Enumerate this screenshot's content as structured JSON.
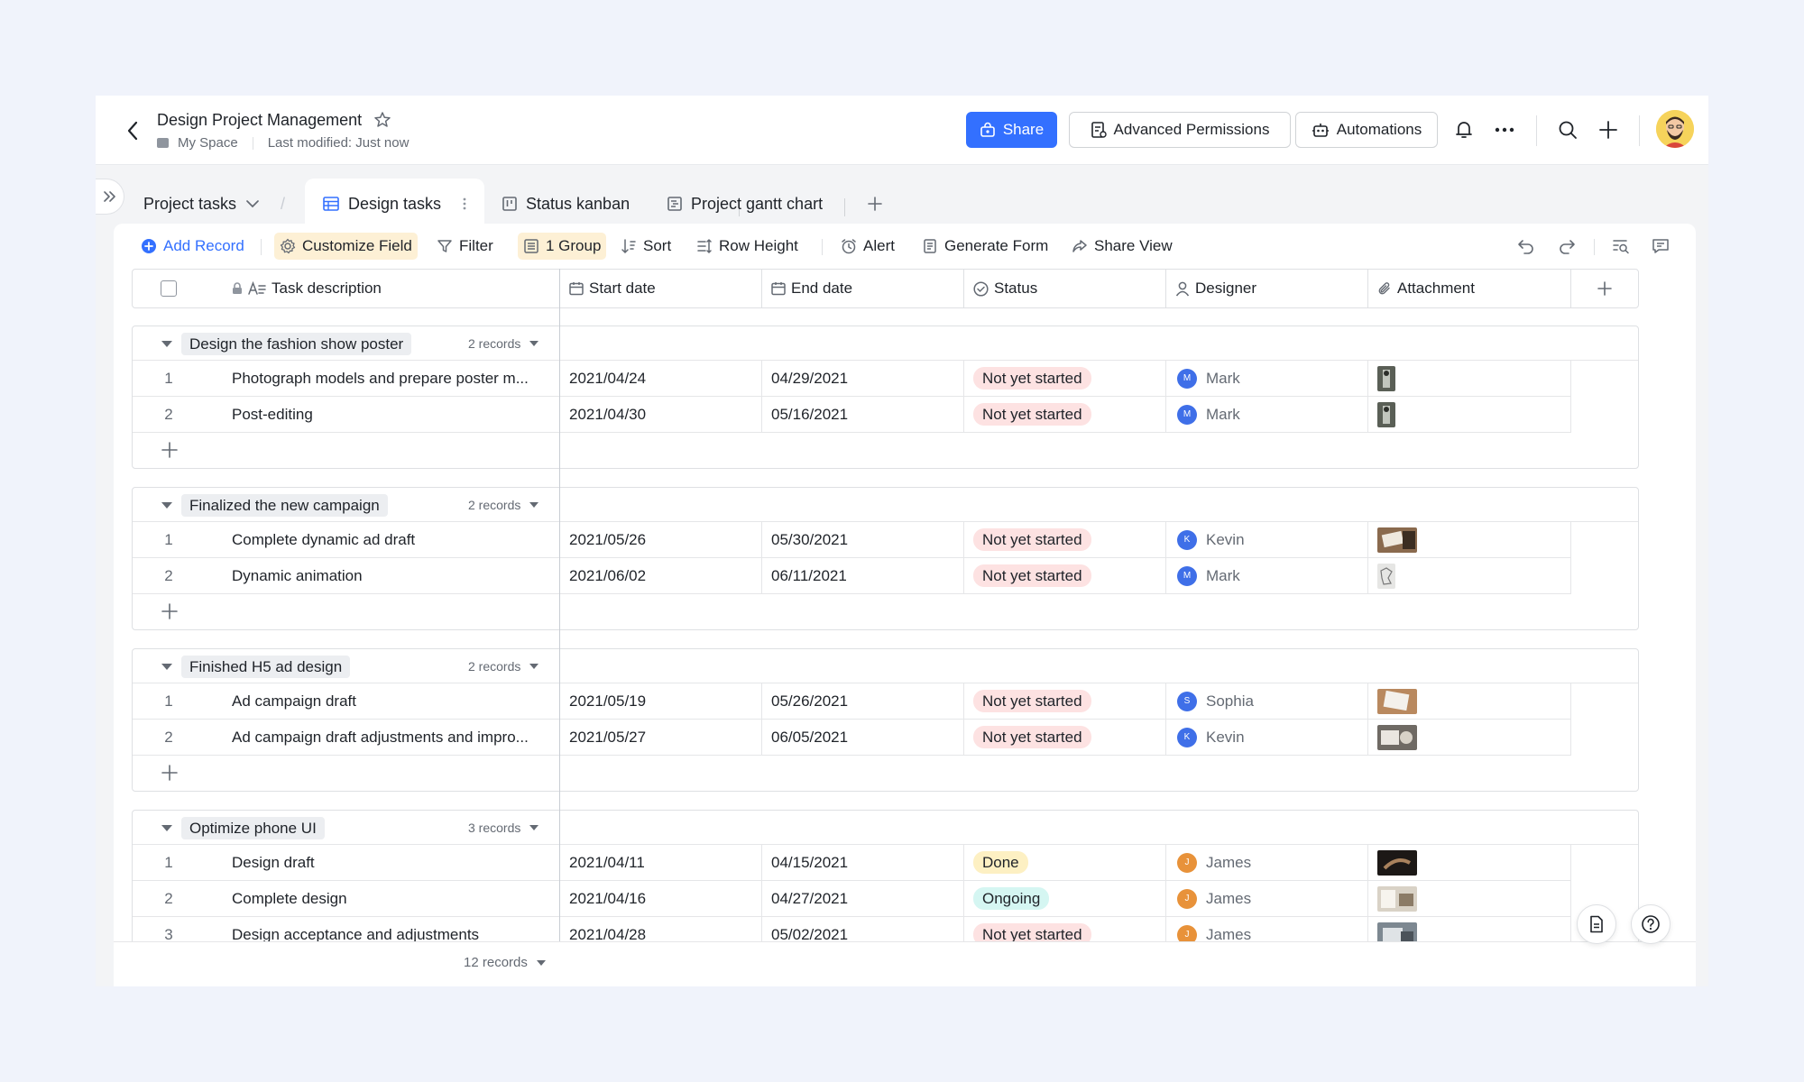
{
  "header": {
    "title": "Design Project Management",
    "breadcrumb_space": "My Space",
    "last_modified": "Last modified: Just now",
    "share_label": "Share",
    "advanced_permissions_label": "Advanced Permissions",
    "automations_label": "Automations"
  },
  "tabs": {
    "project": "Project tasks",
    "items": [
      {
        "label": "Design tasks",
        "icon": "grid-table-icon",
        "active": true
      },
      {
        "label": "Status kanban",
        "icon": "kanban-icon",
        "active": false
      },
      {
        "label": "Project gantt chart",
        "icon": "gantt-icon",
        "active": false
      }
    ]
  },
  "toolbar": {
    "add_record": "Add Record",
    "customize_field": "Customize Field",
    "filter": "Filter",
    "group": "1 Group",
    "sort": "Sort",
    "row_height": "Row Height",
    "alert": "Alert",
    "generate_form": "Generate Form",
    "share_view": "Share View"
  },
  "columns": {
    "task": "Task description",
    "start": "Start date",
    "end": "End date",
    "status": "Status",
    "designer": "Designer",
    "attachment": "Attachment"
  },
  "colors": {
    "accent": "#3370ff",
    "not_started_bg": "#fde2e2",
    "done_bg": "#fdf0c3",
    "ongoing_bg": "#d5f6f2",
    "avatar_blue": "#3f6fe8",
    "avatar_orange": "#e8923a"
  },
  "groups": [
    {
      "name": "Design the fashion show poster",
      "count": "2 records",
      "rows": [
        {
          "num": "1",
          "task": "Photograph models and prepare poster m...",
          "start": "2021/04/24",
          "end": "04/29/2021",
          "status": "Not yet started",
          "designer": "Mark",
          "initial": "M"
        },
        {
          "num": "2",
          "task": "Post-editing",
          "start": "2021/04/30",
          "end": "05/16/2021",
          "status": "Not yet started",
          "designer": "Mark",
          "initial": "M"
        }
      ]
    },
    {
      "name": "Finalized the new campaign",
      "count": "2 records",
      "rows": [
        {
          "num": "1",
          "task": "Complete dynamic ad draft",
          "start": "2021/05/26",
          "end": "05/30/2021",
          "status": "Not yet started",
          "designer": "Kevin",
          "initial": "K"
        },
        {
          "num": "2",
          "task": "Dynamic animation",
          "start": "2021/06/02",
          "end": "06/11/2021",
          "status": "Not yet started",
          "designer": "Mark",
          "initial": "M"
        }
      ]
    },
    {
      "name": "Finished H5 ad design",
      "count": "2 records",
      "rows": [
        {
          "num": "1",
          "task": "Ad campaign draft",
          "start": "2021/05/19",
          "end": "05/26/2021",
          "status": "Not yet started",
          "designer": "Sophia",
          "initial": "S"
        },
        {
          "num": "2",
          "task": "Ad campaign draft adjustments and impro...",
          "start": "2021/05/27",
          "end": "06/05/2021",
          "status": "Not yet started",
          "designer": "Kevin",
          "initial": "K"
        }
      ]
    },
    {
      "name": "Optimize phone UI",
      "count": "3 records",
      "rows": [
        {
          "num": "1",
          "task": "Design draft",
          "start": "2021/04/11",
          "end": "04/15/2021",
          "status": "Done",
          "designer": "James",
          "initial": "J"
        },
        {
          "num": "2",
          "task": "Complete design",
          "start": "2021/04/16",
          "end": "04/27/2021",
          "status": "Ongoing",
          "designer": "James",
          "initial": "J"
        },
        {
          "num": "3",
          "task": "Design acceptance and adjustments",
          "start": "2021/04/28",
          "end": "05/02/2021",
          "status": "Not yet started",
          "designer": "James",
          "initial": "J"
        }
      ]
    }
  ],
  "footer": {
    "total": "12 records"
  }
}
